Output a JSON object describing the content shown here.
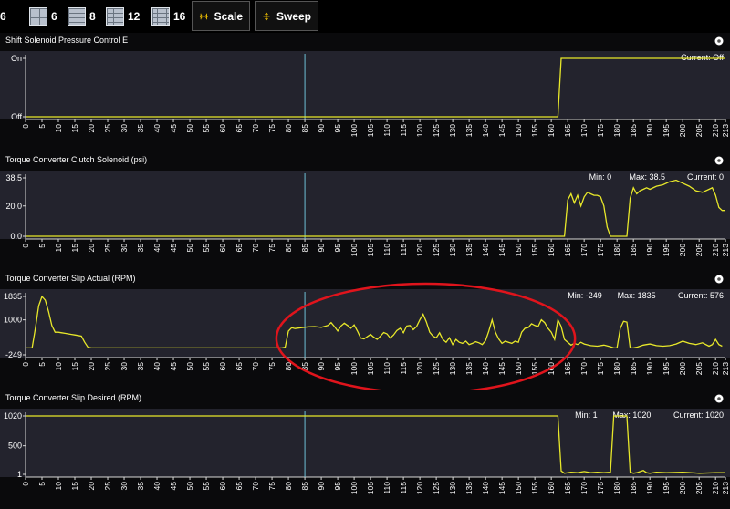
{
  "toolbar": {
    "items": [
      {
        "label": "6",
        "icon": "grid-icon"
      },
      {
        "label": "6",
        "icon": "grid-icon"
      },
      {
        "label": "8",
        "icon": "grid-icon"
      },
      {
        "label": "12",
        "icon": "grid-icon"
      },
      {
        "label": "16",
        "icon": "grid-icon"
      }
    ],
    "scale_label": "Scale",
    "sweep_label": "Sweep",
    "accent": "#f5c400"
  },
  "colors": {
    "plot_bg": "#23232d",
    "line": "#e8e82a",
    "cursor": "#6fc0d6",
    "ellipse": "#e0141c",
    "axis": "#d8d8d8",
    "text": "#ffffff"
  },
  "cursor_x": 85,
  "x_ticks": [
    0,
    5,
    10,
    15,
    20,
    25,
    30,
    35,
    40,
    45,
    50,
    55,
    60,
    65,
    70,
    75,
    80,
    85,
    90,
    95,
    100,
    105,
    110,
    115,
    120,
    125,
    130,
    135,
    140,
    145,
    150,
    155,
    160,
    165,
    170,
    175,
    180,
    185,
    190,
    195,
    200,
    205,
    210,
    213
  ],
  "annotation": {
    "type": "ellipse",
    "x_range": [
      78,
      165
    ],
    "chart_index": 2
  },
  "chart_data": [
    {
      "type": "line",
      "title": "Shift Solenoid Pressure Control E",
      "stats": {
        "current": "Current: Off"
      },
      "y_ticks": [
        {
          "label": "On",
          "value": 1
        },
        {
          "label": "Off",
          "value": 0
        }
      ],
      "ylim": [
        0,
        1
      ],
      "xlim": [
        0,
        213
      ],
      "x": [
        0,
        162,
        163,
        213
      ],
      "y": [
        0,
        0,
        1,
        1
      ]
    },
    {
      "type": "line",
      "title": "Torque Converter Clutch Solenoid (psi)",
      "stats": {
        "min": "Min: 0",
        "max": "Max: 38.5",
        "current": "Current: 0"
      },
      "y_ticks": [
        {
          "label": "38.5",
          "value": 38.5
        },
        {
          "label": "20.0",
          "value": 20
        },
        {
          "label": "0.0",
          "value": 0
        }
      ],
      "ylim": [
        0,
        38.5
      ],
      "xlim": [
        0,
        213
      ],
      "x": [
        0,
        164,
        165,
        166,
        167,
        168,
        169,
        170,
        171,
        172,
        173,
        174,
        175,
        176,
        177,
        178,
        179,
        180,
        181,
        182,
        183,
        184,
        185,
        186,
        187,
        188,
        189,
        190,
        192,
        194,
        196,
        198,
        200,
        202,
        204,
        206,
        208,
        209,
        210,
        211,
        212,
        213
      ],
      "y": [
        0,
        0,
        24,
        28,
        22,
        27,
        20,
        26,
        29,
        28,
        27,
        27,
        26,
        20,
        6,
        0,
        0,
        0,
        0,
        0,
        0,
        25,
        32,
        28,
        30,
        31,
        32,
        31,
        33,
        34,
        36,
        37,
        35,
        33,
        30,
        29,
        31,
        32,
        27,
        19,
        17,
        17
      ]
    },
    {
      "type": "line",
      "title": "Torque Converter Slip Actual (RPM)",
      "stats": {
        "min": "Min: -249",
        "max": "Max: 1835",
        "current": "Current: 576"
      },
      "y_ticks": [
        {
          "label": "1835",
          "value": 1835
        },
        {
          "label": "1000",
          "value": 1000
        },
        {
          "label": "-249",
          "value": -249
        }
      ],
      "ylim": [
        -249,
        1835
      ],
      "xlim": [
        0,
        213
      ],
      "x": [
        0,
        1,
        2,
        3,
        4,
        5,
        6,
        7,
        8,
        9,
        10,
        11,
        12,
        13,
        14,
        15,
        16,
        17,
        18,
        19,
        20,
        25,
        30,
        40,
        50,
        60,
        70,
        78,
        79,
        80,
        81,
        82,
        84,
        86,
        88,
        90,
        92,
        93,
        94,
        95,
        96,
        97,
        98,
        99,
        100,
        101,
        102,
        103,
        104,
        105,
        106,
        107,
        108,
        109,
        110,
        111,
        112,
        113,
        114,
        115,
        116,
        117,
        118,
        119,
        120,
        121,
        122,
        123,
        124,
        125,
        126,
        127,
        128,
        129,
        130,
        131,
        132,
        133,
        134,
        135,
        136,
        137,
        138,
        139,
        140,
        141,
        142,
        143,
        144,
        145,
        146,
        147,
        148,
        149,
        150,
        151,
        152,
        153,
        154,
        155,
        156,
        157,
        158,
        159,
        160,
        161,
        162,
        163,
        164,
        165,
        166,
        167,
        168,
        169,
        170,
        172,
        174,
        176,
        178,
        179,
        180,
        181,
        182,
        183,
        184,
        185,
        186,
        188,
        190,
        192,
        194,
        196,
        198,
        200,
        202,
        204,
        206,
        208,
        209,
        210,
        211,
        212,
        213
      ],
      "y": [
        0,
        0,
        0,
        700,
        1500,
        1835,
        1700,
        1300,
        800,
        560,
        560,
        540,
        520,
        500,
        480,
        460,
        440,
        420,
        200,
        20,
        0,
        0,
        0,
        0,
        0,
        0,
        0,
        0,
        20,
        600,
        720,
        690,
        720,
        750,
        760,
        730,
        800,
        900,
        760,
        600,
        780,
        880,
        800,
        700,
        820,
        600,
        350,
        320,
        400,
        480,
        380,
        300,
        420,
        550,
        500,
        350,
        460,
        620,
        700,
        540,
        780,
        800,
        650,
        760,
        1000,
        1200,
        920,
        560,
        420,
        360,
        540,
        300,
        200,
        360,
        120,
        300,
        200,
        160,
        240,
        120,
        160,
        220,
        180,
        120,
        260,
        600,
        1000,
        560,
        320,
        160,
        240,
        200,
        160,
        240,
        200,
        560,
        700,
        720,
        860,
        800,
        760,
        1000,
        900,
        700,
        560,
        300,
        1000,
        760,
        300,
        200,
        100,
        160,
        120,
        200,
        140,
        80,
        60,
        100,
        40,
        0,
        0,
        700,
        950,
        920,
        0,
        0,
        20,
        100,
        140,
        80,
        60,
        80,
        140,
        240,
        160,
        120,
        180,
        60,
        120,
        300,
        120,
        60
      ],
      "circled_range": [
        78,
        165
      ]
    },
    {
      "type": "line",
      "title": "Torque Converter Slip Desired (RPM)",
      "stats": {
        "min": "Min: 1",
        "max": "Max: 1020",
        "current": "Current: 1020"
      },
      "y_ticks": [
        {
          "label": "1020",
          "value": 1020
        },
        {
          "label": "500",
          "value": 500
        },
        {
          "label": "1",
          "value": 1
        }
      ],
      "ylim": [
        1,
        1020
      ],
      "xlim": [
        0,
        213
      ],
      "x": [
        0,
        162,
        163,
        164,
        166,
        168,
        170,
        172,
        174,
        176,
        178,
        179,
        180,
        181,
        182,
        183,
        184,
        185,
        186,
        188,
        189,
        190,
        192,
        195,
        200,
        205,
        210,
        213
      ],
      "y": [
        1020,
        1020,
        60,
        20,
        40,
        30,
        50,
        30,
        40,
        30,
        40,
        1020,
        1020,
        1020,
        1020,
        1020,
        40,
        20,
        30,
        70,
        30,
        20,
        40,
        30,
        40,
        20,
        30,
        30
      ]
    }
  ]
}
